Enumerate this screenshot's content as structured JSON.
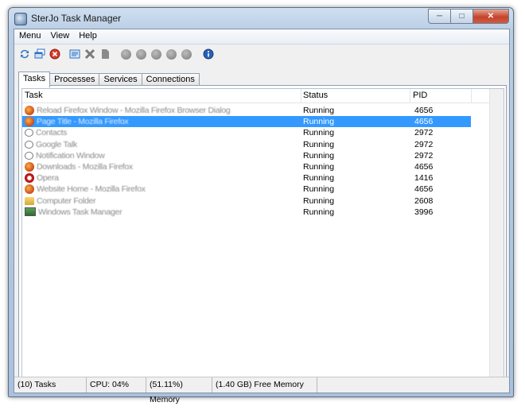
{
  "window": {
    "title": "SterJo Task Manager"
  },
  "menu": [
    "Menu",
    "View",
    "Help"
  ],
  "toolbar": {
    "icons": [
      "refresh-icon",
      "window-icon",
      "stop-icon",
      "properties-icon",
      "close-x-icon",
      "document-icon",
      "gray-dot-icon",
      "gray-dot-icon",
      "gray-dot-icon",
      "gray-dot-icon",
      "gray-dot-icon",
      "info-icon"
    ]
  },
  "tabs": [
    "Tasks",
    "Processes",
    "Services",
    "Connections"
  ],
  "columns": {
    "task": "Task",
    "status": "Status",
    "pid": "PID"
  },
  "rows": [
    {
      "icon": "firefox-icon",
      "task": "Reload Firefox Window - Mozilla Firefox Browser Dialog",
      "status": "Running",
      "pid": "4656",
      "selected": false
    },
    {
      "icon": "firefox-icon",
      "task": "Page Title - Mozilla Firefox",
      "status": "Running",
      "pid": "4656",
      "selected": true
    },
    {
      "icon": "chat-icon",
      "task": "Contacts",
      "status": "Running",
      "pid": "2972",
      "selected": false
    },
    {
      "icon": "chat-icon",
      "task": "Google Talk",
      "status": "Running",
      "pid": "2972",
      "selected": false
    },
    {
      "icon": "chat-icon",
      "task": "Notification Window",
      "status": "Running",
      "pid": "2972",
      "selected": false
    },
    {
      "icon": "firefox-icon",
      "task": "Downloads - Mozilla Firefox",
      "status": "Running",
      "pid": "4656",
      "selected": false
    },
    {
      "icon": "opera-icon",
      "task": "Opera",
      "status": "Running",
      "pid": "1416",
      "selected": false
    },
    {
      "icon": "firefox-icon",
      "task": "Website Home - Mozilla Firefox",
      "status": "Running",
      "pid": "4656",
      "selected": false
    },
    {
      "icon": "folder-icon",
      "task": "Computer Folder",
      "status": "Running",
      "pid": "2608",
      "selected": false
    },
    {
      "icon": "taskmanager-icon",
      "task": "Windows Task Manager",
      "status": "Running",
      "pid": "3996",
      "selected": false
    }
  ],
  "statusbar": {
    "tasks": "(10) Tasks",
    "cpu": "CPU: 04%",
    "memory": "(51.11%) Memory",
    "free_memory": "(1.40 GB) Free Memory"
  }
}
